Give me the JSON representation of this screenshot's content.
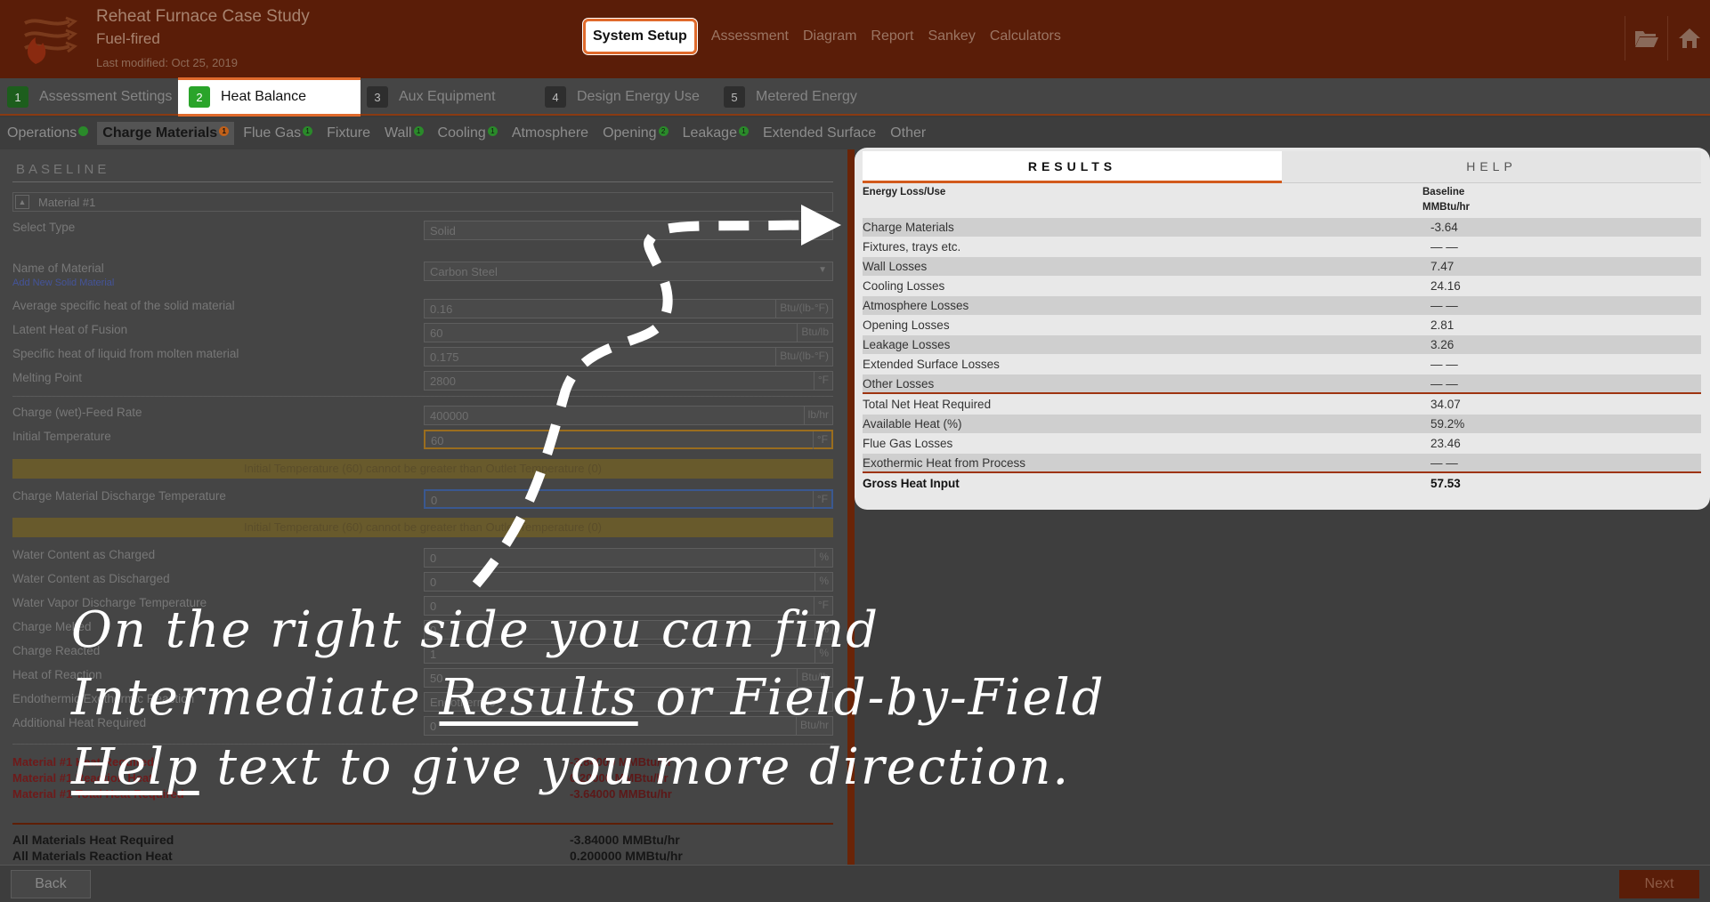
{
  "header": {
    "title": "Reheat Furnace Case Study",
    "subtitle": "Fuel-fired",
    "last_modified": "Last modified: Oct 25, 2019",
    "nav": [
      "System Setup",
      "Assessment",
      "Diagram",
      "Report",
      "Sankey",
      "Calculators"
    ],
    "icons": [
      "folder-open-icon",
      "home-icon"
    ]
  },
  "steps": [
    {
      "num": "1",
      "label": "Assessment Settings"
    },
    {
      "num": "2",
      "label": "Heat Balance"
    },
    {
      "num": "3",
      "label": "Aux Equipment"
    },
    {
      "num": "4",
      "label": "Design Energy Use"
    },
    {
      "num": "5",
      "label": "Metered Energy"
    }
  ],
  "subtabs": [
    {
      "label": "Operations",
      "badge": "",
      "badge_color": "green"
    },
    {
      "label": "Charge Materials",
      "badge": "1",
      "badge_color": "orange"
    },
    {
      "label": "Flue Gas",
      "badge": "1",
      "badge_color": "green"
    },
    {
      "label": "Fixture",
      "badge": "",
      "badge_color": ""
    },
    {
      "label": "Wall",
      "badge": "1",
      "badge_color": "green"
    },
    {
      "label": "Cooling",
      "badge": "1",
      "badge_color": "green"
    },
    {
      "label": "Atmosphere",
      "badge": "",
      "badge_color": ""
    },
    {
      "label": "Opening",
      "badge": "2",
      "badge_color": "green"
    },
    {
      "label": "Leakage",
      "badge": "1",
      "badge_color": "green"
    },
    {
      "label": "Extended Surface",
      "badge": "",
      "badge_color": ""
    },
    {
      "label": "Other",
      "badge": "",
      "badge_color": ""
    }
  ],
  "baseline": {
    "title": "BASELINE",
    "material_header": "Material #1",
    "select_type": {
      "label": "Select Type",
      "value": "Solid"
    },
    "name_of_material": {
      "label": "Name of Material",
      "value": "Carbon Steel",
      "link": "Add New Solid Material"
    },
    "avg_specific_heat": {
      "label": "Average specific heat of the solid material",
      "value": "0.16",
      "unit": "Btu/(lb-°F)"
    },
    "latent_heat": {
      "label": "Latent Heat of Fusion",
      "value": "60",
      "unit": "Btu/lb"
    },
    "specific_heat_liquid": {
      "label": "Specific heat of liquid from molten material",
      "value": "0.175",
      "unit": "Btu/(lb-°F)"
    },
    "melting_point": {
      "label": "Melting Point",
      "value": "2800",
      "unit": "°F"
    },
    "feed_rate": {
      "label": "Charge (wet)-Feed Rate",
      "value": "400000",
      "unit": "lb/hr"
    },
    "initial_temp": {
      "label": "Initial Temperature",
      "value": "60",
      "unit": "°F"
    },
    "warning": "Initial Temperature (60) cannot be greater than Outlet Temperature (0)",
    "discharge_temp": {
      "label": "Charge Material Discharge Temperature",
      "value": "0",
      "unit": "°F"
    },
    "water_charged": {
      "label": "Water Content as Charged",
      "value": "0",
      "unit": "%"
    },
    "water_discharged": {
      "label": "Water Content as Discharged",
      "value": "0",
      "unit": "%"
    },
    "vapor_temp": {
      "label": "Water Vapor Discharge Temperature",
      "value": "0",
      "unit": "°F"
    },
    "charge_melted": {
      "label": "Charge Melted",
      "value": "0",
      "unit": "%"
    },
    "charge_reacted": {
      "label": "Charge Reacted",
      "value": "1",
      "unit": "%"
    },
    "heat_reaction": {
      "label": "Heat of Reaction",
      "value": "50",
      "unit": "Btu/lb"
    },
    "endothermic": {
      "label": "Endothermic/Exothermic Reaction",
      "value": "Endothermic",
      "unit": ""
    },
    "additional_heat": {
      "label": "Additional Heat Required",
      "value": "0",
      "unit": "Btu/hr"
    },
    "material_results": [
      {
        "label": "Material #1 Heat Required",
        "value": "-3.84000 MMBtu/hr"
      },
      {
        "label": "Material #1 Reaction Heat",
        "value": "0.20000 MMBtu/hr"
      },
      {
        "label": "Material #1 Total Heat Required",
        "value": "-3.64000 MMBtu/hr"
      }
    ],
    "summary": [
      {
        "label": "All Materials Heat Required",
        "value": "-3.84000 MMBtu/hr"
      },
      {
        "label": "All Materials Reaction Heat",
        "value": "0.200000 MMBtu/hr"
      }
    ]
  },
  "results": {
    "tabs": [
      "RESULTS",
      "HELP"
    ],
    "col1_header": "Energy Loss/Use",
    "col2_header_1": "Baseline",
    "col2_header_2": "MMBtu/hr",
    "rows": [
      {
        "label": "Charge Materials",
        "value": "-3.64"
      },
      {
        "label": "Fixtures, trays etc.",
        "value": "— —"
      },
      {
        "label": "Wall Losses",
        "value": "7.47"
      },
      {
        "label": "Cooling Losses",
        "value": "24.16"
      },
      {
        "label": "Atmosphere Losses",
        "value": "— —"
      },
      {
        "label": "Opening Losses",
        "value": "2.81"
      },
      {
        "label": "Leakage Losses",
        "value": "3.26"
      },
      {
        "label": "Extended Surface Losses",
        "value": "— —"
      },
      {
        "label": "Other Losses",
        "value": "— —"
      },
      {
        "label": "Total Net Heat Required",
        "value": "34.07"
      },
      {
        "label": "Available Heat (%)",
        "value": "59.2%"
      },
      {
        "label": "Flue Gas Losses",
        "value": "23.46"
      },
      {
        "label": "Exothermic Heat from Process",
        "value": "— —"
      },
      {
        "label": "Gross Heat Input",
        "value": "57.53"
      }
    ]
  },
  "footer": {
    "back": "Back",
    "next": "Next"
  },
  "overlay": {
    "line1": "On the right side you can find",
    "line2_a": "Intermediate ",
    "line2_b": "Results",
    "line2_c": " or Field-by-Field",
    "line3_a": "Help",
    "line3_b": " text to give you more direction."
  },
  "colors": {
    "brand": "#5a1d08",
    "accent": "#e06a2c",
    "success": "#2aa42a"
  }
}
